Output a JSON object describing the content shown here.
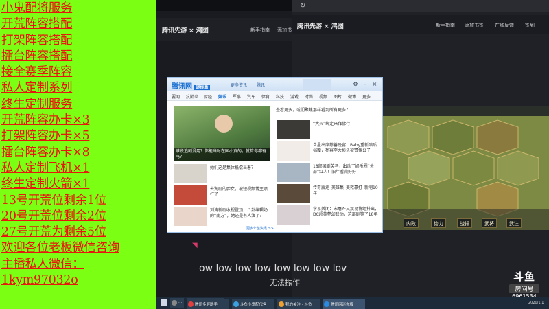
{
  "promo": {
    "lines": [
      "小鬼配将服务",
      "开荒阵容搭配",
      "打架阵容搭配",
      "擂台阵容搭配",
      "接全赛季阵容",
      "私人定制系列",
      "终生定制服务",
      "开荒阵容办卡×3",
      "打架阵容办卡×5",
      "擂台阵容办卡×8",
      "私人定制飞机×1",
      "终生定制火箭×1",
      "13号开荒位剩余1位",
      "20号开荒位剩余2位",
      "27号开荒为剩余5位",
      "欢迎各位老板微信咨询",
      "主播私人微信：",
      "1kym97032o"
    ]
  },
  "mid_browser": {
    "logo": "腾讯先游 × 鸿图",
    "nav": [
      "新手指南",
      "添加书"
    ]
  },
  "right_browser": {
    "logo": "腾讯先游 × 鸿图",
    "nav": [
      "新手指南",
      "添加书签",
      "在线反馈",
      "签到"
    ],
    "game_buttons": [
      "内政",
      "势力",
      "战报",
      "武将",
      "武注"
    ]
  },
  "popup": {
    "brand": "腾讯网",
    "brand_sub": "迷你版",
    "title_links": [
      "更多资讯",
      "腾讯",
      "设置"
    ],
    "tabs": [
      "要闻",
      "抗肺炎",
      "财经",
      "娱乐",
      "军事",
      "汽车",
      "体育",
      "科技",
      "游戏",
      "时尚",
      "视频",
      "图片",
      "微博",
      "更多"
    ],
    "active_tab": "娱乐",
    "hero_caption": "谁说追剧没用？你能当时在国小真的，就算你都有吗？",
    "top_link": "查看更多，或们聚焦那样看到所有更多？",
    "left_news": [
      "她们这是集体抵偿当着？",
      "去淘剧的脸女，被短视频博主喷打了",
      "刘涛新剧收视登顶，八卦编辑奶的“南方”，她还是有人演了？"
    ],
    "right_news": [
      "“大火”绑定来拜佛行",
      "众星出席慈善晚宴：Baby重新陪后捐赠，杨幂李大彬头被赞像公子",
      "18部国剧英马，出动了娱乐圈“头部”红人！旧年看完好好",
      "传奇震走_英雄集_美救靠打_新明10年！",
      "李易关闭：宋屠昨又双易将组排出，DC超英梦幻联动，这部剧等了18年"
    ],
    "footer": "更多年鉴资讯 >>"
  },
  "subtitle": {
    "line1": "ow low low low low low low lov",
    "line2": "无法振作"
  },
  "taskbar": {
    "items": [
      "...",
      "perTrueGame",
      "腾讯多屏助手",
      "斗鱼小鬼配代售",
      "我的关注 - 斗鱼",
      "腾讯网迷你版"
    ],
    "clock": "2020/1/1"
  },
  "watermark": {
    "logo": "斗鱼",
    "label": "房间号",
    "room": "6961534"
  },
  "colors": {
    "promo_bg": "#7bff12",
    "promo_text": "#e8140e",
    "accent": "#1a6fd0"
  }
}
